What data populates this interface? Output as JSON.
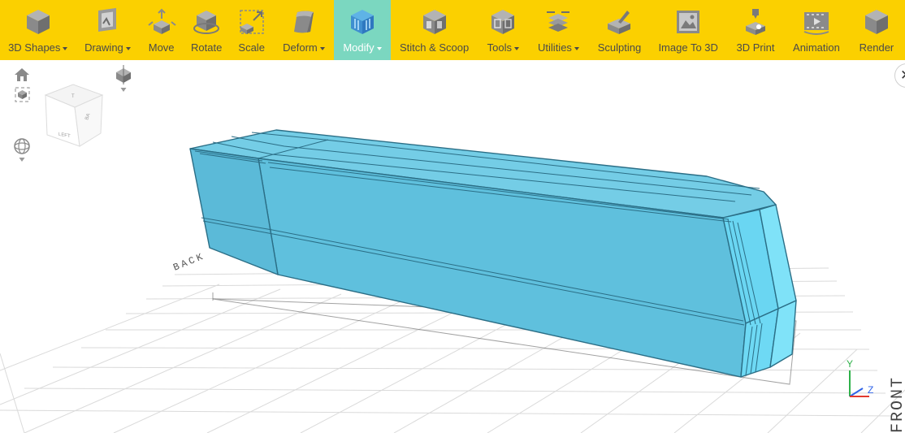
{
  "toolbar": {
    "items": [
      {
        "label": "3D Shapes",
        "dropdown": true,
        "icon": "cube-icon"
      },
      {
        "label": "Drawing",
        "dropdown": true,
        "icon": "drawing-icon"
      },
      {
        "label": "Move",
        "dropdown": false,
        "icon": "move-icon"
      },
      {
        "label": "Rotate",
        "dropdown": false,
        "icon": "rotate-icon"
      },
      {
        "label": "Scale",
        "dropdown": false,
        "icon": "scale-icon"
      },
      {
        "label": "Deform",
        "dropdown": true,
        "icon": "deform-icon"
      },
      {
        "label": "Modify",
        "dropdown": true,
        "icon": "modify-icon",
        "active": true
      },
      {
        "label": "Stitch & Scoop",
        "dropdown": false,
        "icon": "stitch-scoop-icon"
      },
      {
        "label": "Tools",
        "dropdown": true,
        "icon": "tools-icon"
      },
      {
        "label": "Utilities",
        "dropdown": true,
        "icon": "utilities-icon"
      },
      {
        "label": "Sculpting",
        "dropdown": false,
        "icon": "sculpting-icon"
      },
      {
        "label": "Image To 3D",
        "dropdown": false,
        "icon": "image-to-3d-icon"
      },
      {
        "label": "3D Print",
        "dropdown": false,
        "icon": "3d-print-icon"
      },
      {
        "label": "Animation",
        "dropdown": false,
        "icon": "animation-icon"
      },
      {
        "label": "Render",
        "dropdown": false,
        "icon": "render-icon"
      }
    ]
  },
  "view_cube": {
    "face_left": "LEFT",
    "face_top": "T",
    "face_right": "BA"
  },
  "viewport": {
    "label_back": "BACK",
    "label_front": "FRONT",
    "axes": {
      "y": "Y",
      "z": "Z"
    }
  },
  "close_button": {
    "glyph": "✕"
  },
  "colors": {
    "toolbar_bg": "#fbd000",
    "active_tool_bg": "#7bd7c0",
    "model_fill": "#5fc1dd",
    "model_edge": "#2b6e86",
    "grid": "#d8d8d8",
    "axis_y": "#2fb14a",
    "axis_z": "#2f63e8",
    "axis_x": "#e23a2f"
  }
}
